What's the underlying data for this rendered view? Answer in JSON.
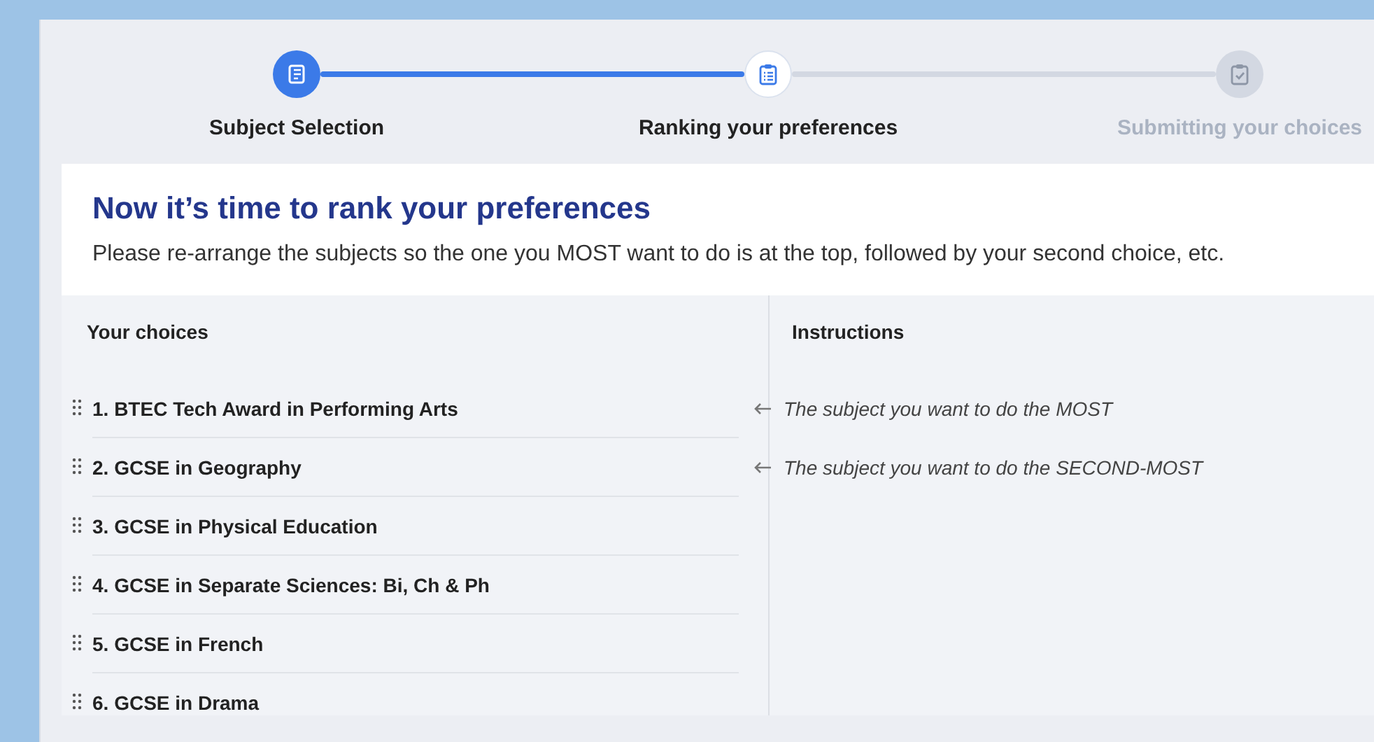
{
  "steps": [
    {
      "label": "Subject Selection",
      "done": true,
      "selected": false
    },
    {
      "label": "Ranking your preferences",
      "done": false,
      "selected": true
    },
    {
      "label": "Submitting your choices",
      "done": false,
      "selected": false
    }
  ],
  "intro": {
    "title": "Now it’s time to rank your preferences",
    "text": "Please re-arrange the subjects so the one you MOST want to do is at the top, followed by your second choice, etc."
  },
  "choices": {
    "heading": "Your choices",
    "items": [
      "1. BTEC Tech Award in Performing Arts",
      "2. GCSE in Geography",
      "3. GCSE in Physical Education",
      "4. GCSE in Separate Sciences: Bi, Ch & Ph",
      "5. GCSE in French",
      "6. GCSE in Drama"
    ]
  },
  "instructions": {
    "heading": "Instructions",
    "items": [
      "The subject you want to do the MOST",
      "The subject you want to do the SECOND-MOST"
    ]
  }
}
